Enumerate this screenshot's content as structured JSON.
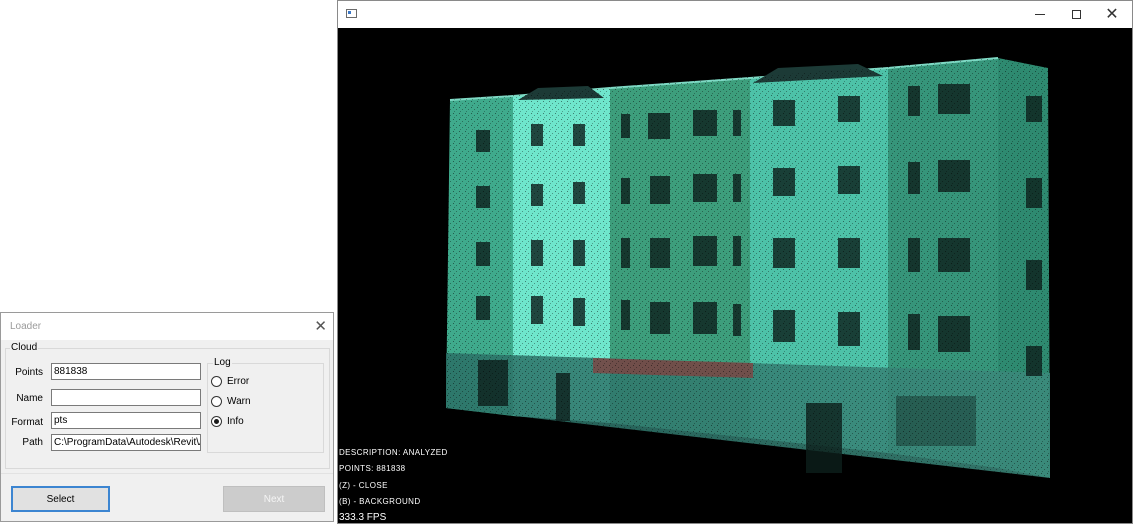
{
  "viewer": {
    "title": "",
    "overlay": {
      "description": "DESCRIPTION: ANALYZED",
      "points": "POINTS: 881838",
      "close_hint": "(Z) - CLOSE",
      "background_hint": "(B) - BACKGROUND",
      "fps": "333.3 FPS"
    },
    "colors": {
      "background": "#000000",
      "cloud_dark": "#2f8f7a",
      "cloud_light": "#7ef0d8"
    }
  },
  "loader": {
    "title": "Loader",
    "cloud_group_label": "Cloud",
    "fields": {
      "points_label": "Points",
      "points_value": "881838",
      "name_label": "Name",
      "name_value": "",
      "format_label": "Format",
      "format_value": "pts",
      "path_label": "Path",
      "path_value": "C:\\ProgramData\\Autodesk\\Revit\\A"
    },
    "log_group_label": "Log",
    "log_options": {
      "error": "Error",
      "warn": "Warn",
      "info": "Info"
    },
    "log_selected": "Info",
    "buttons": {
      "select": "Select",
      "next": "Next"
    }
  }
}
